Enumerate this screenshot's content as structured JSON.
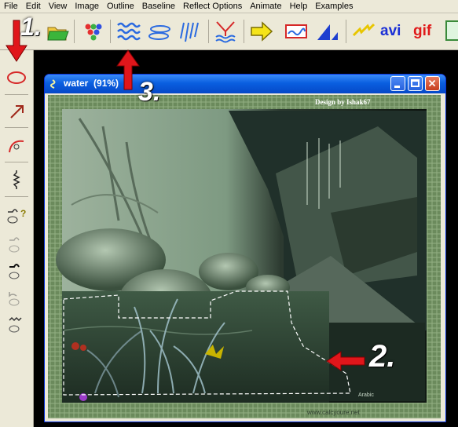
{
  "menu": [
    "File",
    "Edit",
    "View",
    "Image",
    "Outline",
    "Baseline",
    "Reflect Options",
    "Animate",
    "Help",
    "Examples"
  ],
  "toolbar": {
    "avi_label": "avi",
    "gif_label": "gif"
  },
  "window": {
    "title": "water",
    "zoom": "(91%)"
  },
  "image": {
    "credit": "Design by Ishak67",
    "bottom_text": "Arabic",
    "website": "www.calcyoure.net"
  },
  "annotations": {
    "step1": "1.",
    "step2": "2.",
    "step3": "3."
  },
  "colors": {
    "annotation_arrow": "#e0161b",
    "titlebar": "#0a5fe0",
    "selection": "#ffffff"
  }
}
